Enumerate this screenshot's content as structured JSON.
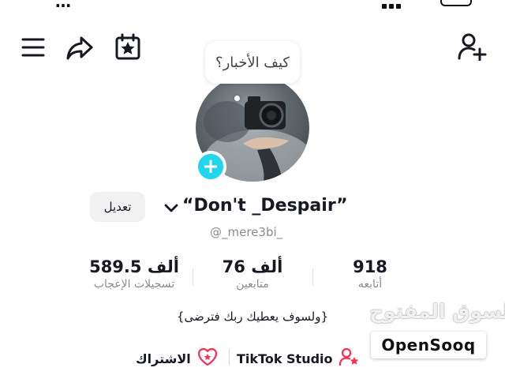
{
  "toolbar": {
    "menu_icon": "hamburger-menu-icon",
    "share_icon": "share-arrow-icon",
    "calendar_icon": "calendar-star-icon",
    "add_friend_icon": "add-user-icon"
  },
  "profile": {
    "bubble_text": "كيف الأخبار؟",
    "display_name": "“Don't _Despair”",
    "username": "@_mere3bi_",
    "edit_label": "تعديل",
    "bio": "{ولسوف يعطيك ربك فترضى}"
  },
  "stats": {
    "likes_value": "589.5 ألف",
    "likes_label": "تسجيلات الإعجاب",
    "followers_value": "76 ألف",
    "followers_label": "متابعين",
    "following_value": "918",
    "following_label": "أتابعه"
  },
  "links": {
    "studio_label": "TikTok Studio",
    "subscription_label": "الاشتراك"
  },
  "watermark": {
    "arabic": "السوق المفتوح",
    "brand": "OpenSooq"
  },
  "colors": {
    "accent_cyan": "#20d5ec",
    "accent_pink": "#fe2c55",
    "text_primary": "#161823",
    "text_secondary": "#8a8b91"
  }
}
